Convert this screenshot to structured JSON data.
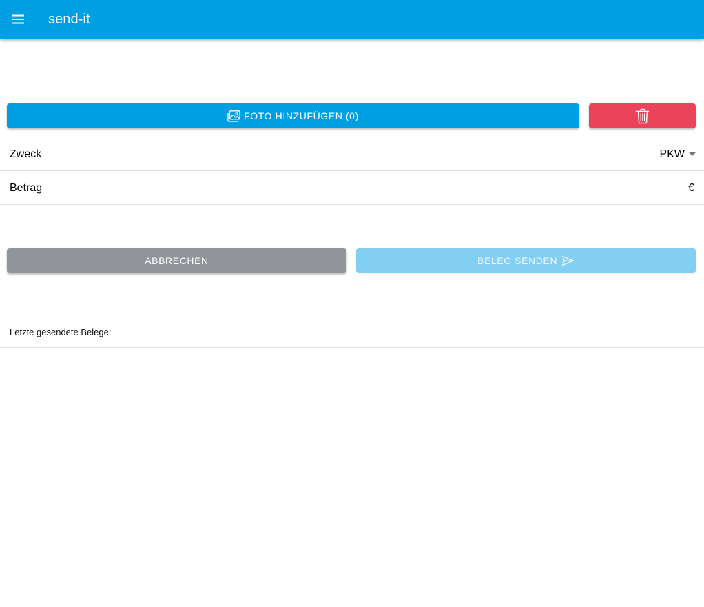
{
  "app": {
    "title": "send-it",
    "menu_icon": "menu-icon"
  },
  "colors": {
    "primary": "#009fe3",
    "danger": "#eb445a",
    "medium": "#92949c",
    "primary_disabled": "#83cff2"
  },
  "photo_button": {
    "label": "FOTO HINZUFÜGEN (0)",
    "icon": "image-icon"
  },
  "delete_button": {
    "icon": "trash-icon"
  },
  "form": {
    "zweck_label": "Zweck",
    "zweck_value": "PKW",
    "betrag_label": "Betrag",
    "betrag_value": "€"
  },
  "actions": {
    "cancel_label": "ABBRECHEN",
    "send_label": "BELEG SENDEN",
    "send_icon": "send-icon"
  },
  "recent": {
    "label": "Letzte gesendete Belege:"
  }
}
